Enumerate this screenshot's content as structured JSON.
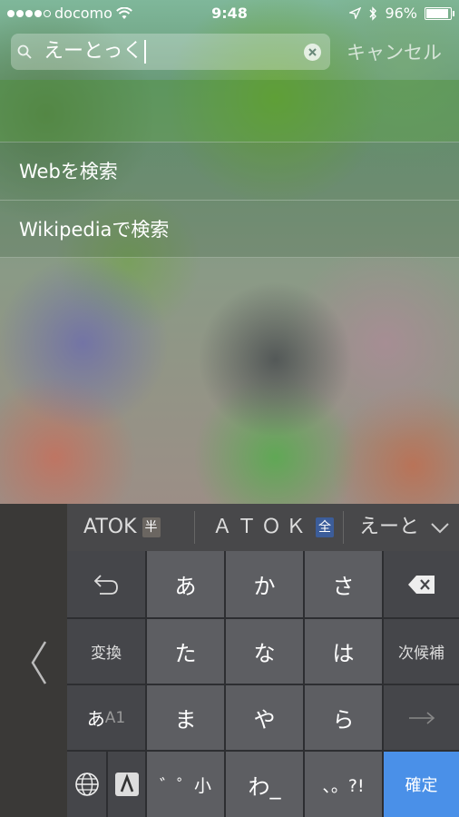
{
  "status_bar": {
    "carrier": "docomo",
    "time": "9:48",
    "battery": "96%",
    "signal_dots_filled": 4,
    "signal_dots_total": 5
  },
  "search": {
    "query": "えーとっく",
    "cancel_label": "キャンセル"
  },
  "results": [
    {
      "label": "Webを検索"
    },
    {
      "label": "Wikipediaで検索"
    }
  ],
  "keyboard": {
    "suggestions": [
      {
        "text": "ATOK",
        "badge": "半"
      },
      {
        "text": "ＡＴＯＫ",
        "badge": "全"
      },
      {
        "text": "えーと"
      }
    ],
    "rows": [
      [
        "undo",
        "あ",
        "か",
        "さ",
        "delete"
      ],
      [
        "変換",
        "た",
        "な",
        "は",
        "次候補"
      ],
      [
        "あA1",
        "ま",
        "や",
        "ら",
        "→"
      ],
      [
        "globe",
        "ﾟﾞ小",
        "わ_",
        "、。?!",
        "確定"
      ]
    ],
    "mode_key": {
      "main": "あ",
      "sub": "A1"
    },
    "confirm_label": "確定",
    "dakuten_label": "゛゜小",
    "wa_label": "わ_",
    "punct_label": "、。?!",
    "colors": {
      "confirm": "#4a90e8",
      "key_light": "#5d5e62",
      "key_dark": "#45464a"
    }
  }
}
